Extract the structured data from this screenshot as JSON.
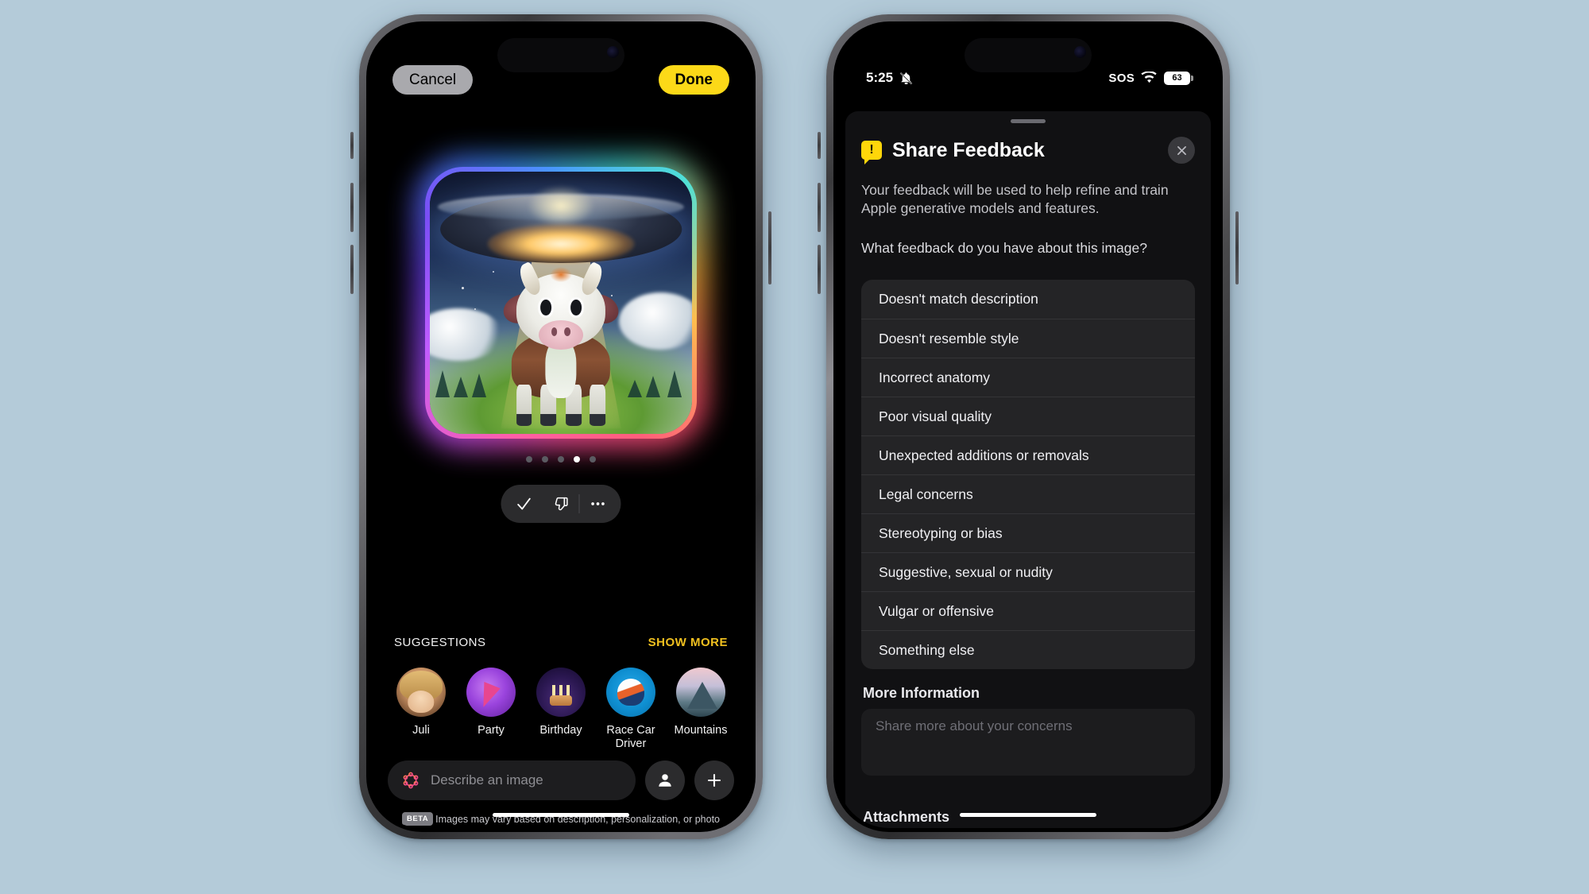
{
  "background_color": "#b4cbd9",
  "left_phone": {
    "topbar": {
      "cancel_label": "Cancel",
      "done_label": "Done"
    },
    "image_card": {
      "description": "Cartoon cow being abducted by a glowing UFO over a grassy field at dusk"
    },
    "page_dots": {
      "total": 5,
      "active_index": 3
    },
    "actions": [
      {
        "name": "check-icon",
        "glyph": "✓"
      },
      {
        "name": "thumbs-down-icon",
        "glyph": "👎"
      },
      {
        "name": "more-icon",
        "glyph": "…"
      }
    ],
    "suggestions": {
      "title": "SUGGESTIONS",
      "show_more_label": "SHOW MORE",
      "items": [
        {
          "label": "Juli",
          "avatar": "person-photo"
        },
        {
          "label": "Party",
          "avatar": "party-popper"
        },
        {
          "label": "Birthday",
          "avatar": "birthday-cake"
        },
        {
          "label": "Race Car Driver",
          "avatar": "racing-helmet"
        },
        {
          "label": "Mountains",
          "avatar": "mountain"
        }
      ]
    },
    "composer": {
      "placeholder": "Describe an image",
      "sparkle_icon": "image-playground-icon",
      "person_button": "person-icon",
      "add_button": "plus-icon"
    },
    "footer": {
      "beta_tag": "BETA",
      "note": "Images may vary based on description, personalization, or photo selected."
    }
  },
  "right_phone": {
    "status_bar": {
      "time": "5:25",
      "mute_icon": "bell-slash-icon",
      "sos": "SOS",
      "wifi_icon": "wifi-icon",
      "battery_level": "63"
    },
    "sheet": {
      "icon": "feedback-bubble-icon",
      "icon_glyph": "!",
      "title": "Share Feedback",
      "close_label": "✕",
      "description": "Your feedback will be used to help refine and train Apple generative models and features.",
      "question": "What feedback do you have about this image?",
      "options": [
        "Doesn't match description",
        "Doesn't resemble style",
        "Incorrect anatomy",
        "Poor visual quality",
        "Unexpected additions or removals",
        "Legal concerns",
        "Stereotyping or bias",
        "Suggestive, sexual or nudity",
        "Vulgar or offensive",
        "Something else"
      ],
      "more_information_label": "More Information",
      "more_information_placeholder": "Share more about your concerns",
      "attachments_label": "Attachments"
    }
  }
}
